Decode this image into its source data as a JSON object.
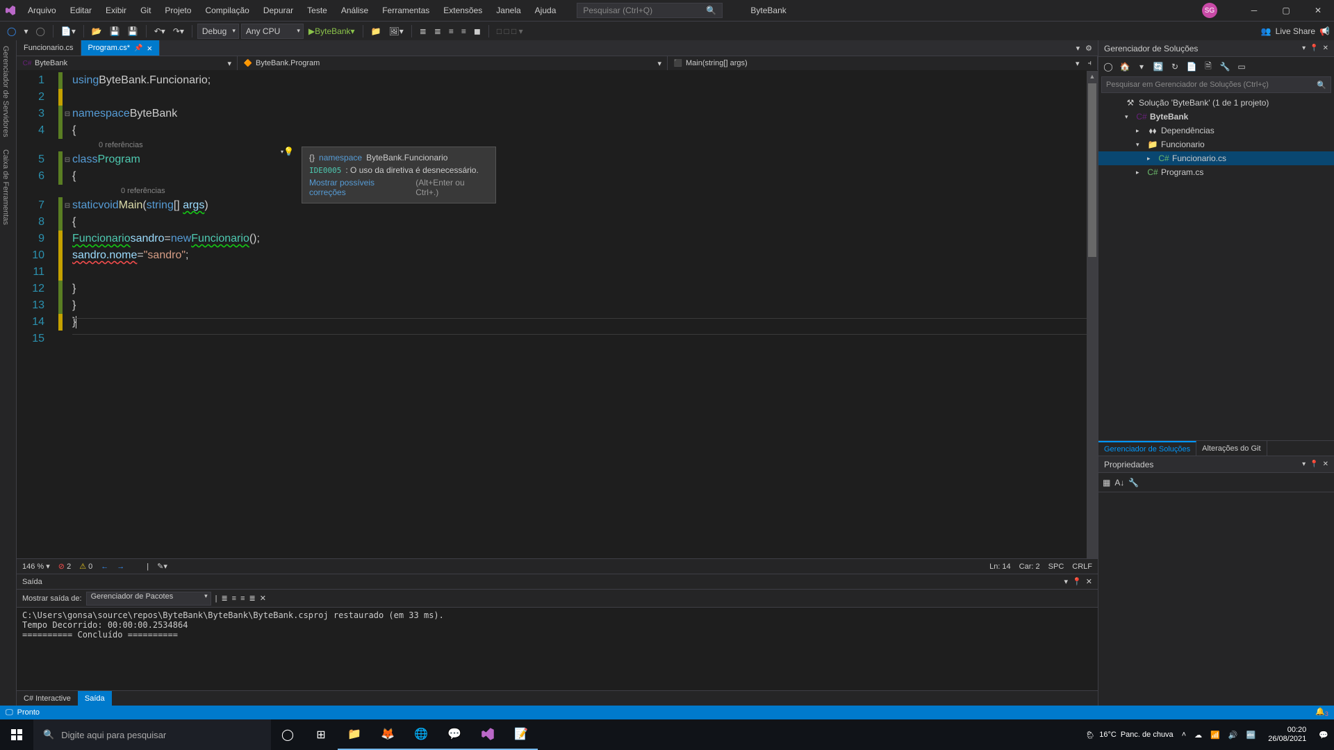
{
  "titlebar": {
    "menu": [
      "Arquivo",
      "Editar",
      "Exibir",
      "Git",
      "Projeto",
      "Compilação",
      "Depurar",
      "Teste",
      "Análise",
      "Ferramentas",
      "Extensões",
      "Janela",
      "Ajuda"
    ],
    "search_placeholder": "Pesquisar (Ctrl+Q)",
    "appname": "ByteBank",
    "avatar": "SG"
  },
  "toolbar": {
    "config": "Debug",
    "platform": "Any CPU",
    "start": "ByteBank",
    "live": "Live Share"
  },
  "tabs": {
    "t1": "Funcionario.cs",
    "t2": "Program.cs*"
  },
  "nav": {
    "project": "ByteBank",
    "class": "ByteBank.Program",
    "method": "Main(string[] args)"
  },
  "codelens": {
    "a": "0 referências",
    "b": "0 referências"
  },
  "tooltip": {
    "ns": "namespace",
    "nsname": "ByteBank.Funcionario",
    "code": "IDE0005",
    "msg": ": O uso da diretiva é desnecessário.",
    "link": "Mostrar possíveis correções",
    "shortcut": "(Alt+Enter ou Ctrl+.)"
  },
  "statusbar_editor": {
    "zoom": "146 %",
    "errors": "2",
    "warnings": "0",
    "ln": "Ln: 14",
    "car": "Car: 2",
    "spc": "SPC",
    "crlf": "CRLF"
  },
  "solution": {
    "title": "Gerenciador de Soluções",
    "search": "Pesquisar em Gerenciador de Soluções (Ctrl+ç)",
    "root": "Solução 'ByteBank' (1 de 1 projeto)",
    "proj": "ByteBank",
    "deps": "Dependências",
    "folder": "Funcionario",
    "file1": "Funcionario.cs",
    "file2": "Program.cs"
  },
  "right_tabs": {
    "a": "Gerenciador de Soluções",
    "b": "Alterações do Git"
  },
  "props": {
    "title": "Propriedades"
  },
  "output": {
    "title": "Saída",
    "from_label": "Mostrar saída de:",
    "from": "Gerenciador de Pacotes",
    "text": "C:\\Users\\gonsa\\source\\repos\\ByteBank\\ByteBank\\ByteBank.csproj restaurado (em 33 ms).\nTempo Decorrido: 00:00:00.2534864\n========== Concluído ==========",
    "tab_a": "C# Interactive",
    "tab_b": "Saída"
  },
  "left_sidebar": {
    "a": "Gerenciador de Servidores",
    "b": "Caixa de Ferramentas"
  },
  "bottom_status": "Pronto",
  "taskbar": {
    "search": "Digite aqui para pesquisar",
    "weather_temp": "16°C",
    "weather_desc": "Panc. de chuva",
    "time": "00:20",
    "date": "26/08/2021"
  }
}
